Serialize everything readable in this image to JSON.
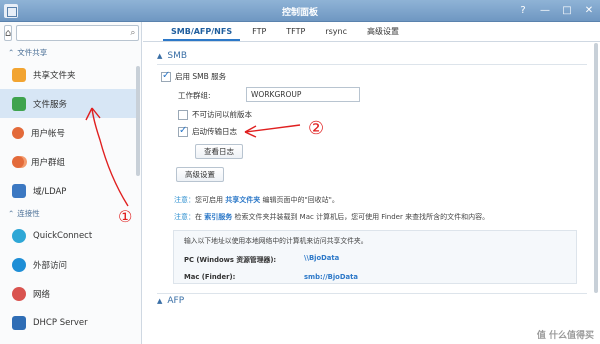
{
  "window": {
    "title": "控制面板",
    "buttons": [
      "?",
      "—",
      "□",
      "✕"
    ]
  },
  "sidebar": {
    "search": {
      "placeholder": "",
      "icon": "search-icon"
    },
    "sections": [
      {
        "label": "文件共享"
      },
      {
        "label": "连接性"
      }
    ],
    "items": [
      {
        "label": "共享文件夹",
        "icon": "shared-folder-icon"
      },
      {
        "label": "文件服务",
        "icon": "file-service-icon",
        "active": true
      },
      {
        "label": "用户帐号",
        "icon": "user-icon"
      },
      {
        "label": "用户群组",
        "icon": "group-icon"
      },
      {
        "label": "域/LDAP",
        "icon": "domain-icon"
      },
      {
        "label": "QuickConnect",
        "icon": "quickconnect-icon"
      },
      {
        "label": "外部访问",
        "icon": "external-access-icon"
      },
      {
        "label": "网络",
        "icon": "network-icon"
      },
      {
        "label": "DHCP Server",
        "icon": "dhcp-icon"
      }
    ]
  },
  "tabs": [
    {
      "label": "SMB/AFP/NFS",
      "active": true
    },
    {
      "label": "FTP"
    },
    {
      "label": "TFTP"
    },
    {
      "label": "rsync"
    },
    {
      "label": "高级设置"
    }
  ],
  "smb": {
    "header": "SMB",
    "enable_label": "启用 SMB 服务",
    "enable_checked": true,
    "workgroup_label": "工作群组:",
    "workgroup_value": "WORKGROUP",
    "prev_version_label": "不可访问以前版本",
    "prev_version_checked": false,
    "log_label": "启动传输日志",
    "log_checked": true,
    "view_log_button": "查看日志",
    "advanced_button": "高级设置",
    "note1": {
      "label": "注意：",
      "pre": "您可启用 ",
      "link": "共享文件夹",
      "post": " 编辑页面中的\"回收站\"。"
    },
    "note2": {
      "label": "注意：",
      "pre": "在 ",
      "link": "索引服务",
      "post": " 检索文件夹并装载到 Mac 计算机后，您可使用 Finder 来查找所含的文件和内容。"
    },
    "info": {
      "intro": "输入以下地址以使用本地网络中的计算机来访问共享文件夹。",
      "rows": [
        {
          "key": "PC (Windows 资源管理器):",
          "value": "\\\\BjoData"
        },
        {
          "key": "Mac (Finder):",
          "value": "smb://BjoData"
        }
      ]
    }
  },
  "afp": {
    "header": "AFP"
  },
  "annotations": {
    "mark1": "①",
    "mark2": "②",
    "color": "#e02020"
  },
  "watermark": "值 什么值得买"
}
